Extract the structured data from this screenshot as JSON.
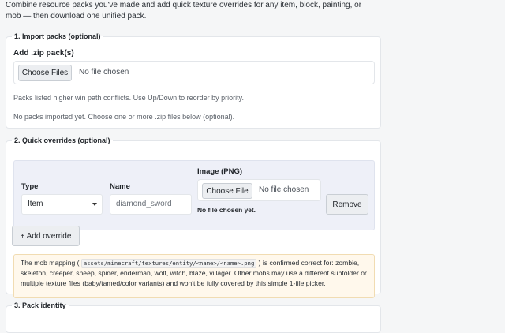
{
  "intro": {
    "text": "Combine resource packs you've made and add quick texture overrides for any item, block, painting, or mob — then download one unified pack."
  },
  "import_section": {
    "legend": "1. Import packs (optional)",
    "field_label": "Add .zip pack(s)",
    "choose_files_label": "Choose Files",
    "file_status": "No file chosen",
    "hint": "Packs listed higher win path conflicts. Use Up/Down to reorder by priority.",
    "empty_message": "No packs imported yet. Choose one or more .zip files below (optional)."
  },
  "overrides_section": {
    "legend": "2. Quick overrides (optional)",
    "type_label": "Type",
    "type_value": "Item",
    "name_label": "Name",
    "name_placeholder": "diamond_sword",
    "image_label": "Image (PNG)",
    "choose_file_label": "Choose File",
    "file_status": "No file chosen",
    "file_status_below": "No file chosen yet.",
    "remove_label": "Remove",
    "add_override_label": "+ Add override",
    "note": {
      "before": "The mob mapping ( ",
      "code": "assets/minecraft/textures/entity/<name>/<name>.png",
      "after": " ) is confirmed correct for: zombie, skeleton, creeper, sheep, spider, enderman, wolf, witch, blaze, villager. Other mobs may use a different subfolder or multiple texture files (baby/tamed/color variants) and won't be fully covered by this simple 1-file picker."
    }
  },
  "identity_section": {
    "legend": "3. Pack identity"
  }
}
